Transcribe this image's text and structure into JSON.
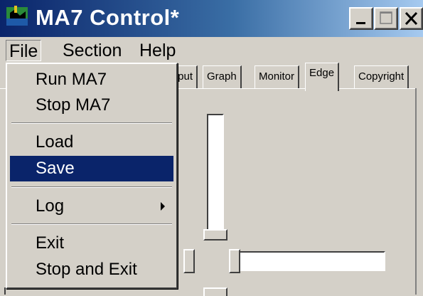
{
  "window": {
    "title": "MA7 Control*",
    "icons": {
      "app": "ma7-app-icon",
      "minimize": "minimize-icon",
      "maximize": "maximize-icon",
      "close": "close-icon"
    }
  },
  "menubar": {
    "items": [
      {
        "label": "File",
        "active": true
      },
      {
        "label": "Section",
        "active": false
      },
      {
        "label": "Help",
        "active": false
      }
    ]
  },
  "file_menu": {
    "items": [
      {
        "label": "Run MA7"
      },
      {
        "label": "Stop MA7"
      },
      {
        "label": "Load"
      },
      {
        "label": "Save",
        "highlighted": true
      },
      {
        "label": "Log",
        "has_submenu": true
      },
      {
        "label": "Exit"
      },
      {
        "label": "Stop and Exit"
      }
    ]
  },
  "tabs": [
    {
      "label": "tput",
      "selected": false
    },
    {
      "label": "Graph",
      "selected": false
    },
    {
      "label": "Monitor",
      "selected": false
    },
    {
      "label": "Edge",
      "selected": true
    },
    {
      "label": "Copyright",
      "selected": false
    }
  ],
  "colors": {
    "face": "#d4d0c8",
    "title_dark": "#0a246a",
    "title_light": "#a6caf0",
    "highlight": "#0a246a",
    "highlight_text": "#ffffff"
  }
}
